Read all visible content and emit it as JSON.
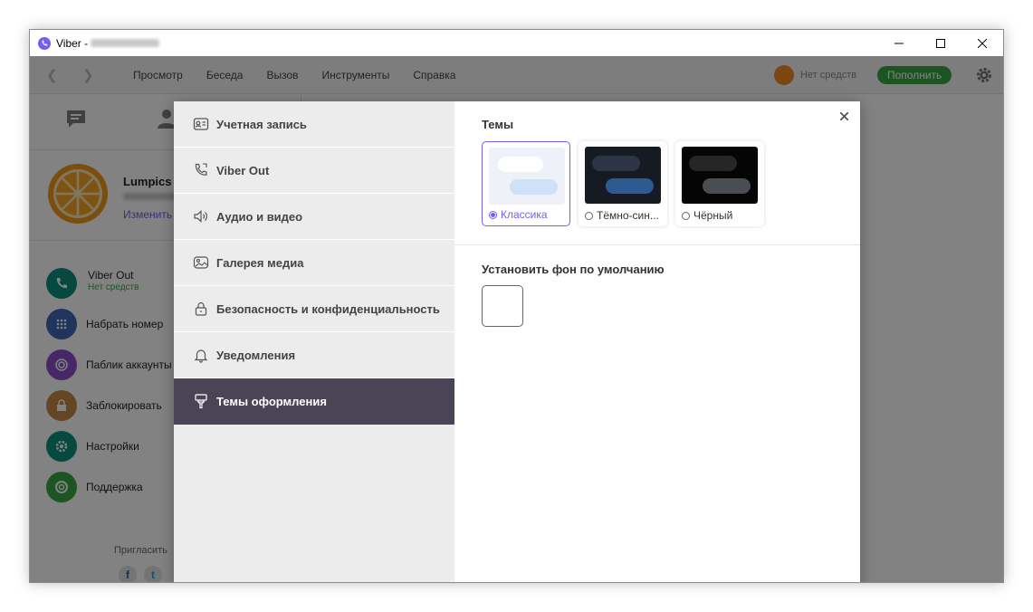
{
  "window": {
    "title": "Viber - ",
    "minimize": "minimize",
    "maximize": "maximize",
    "close": "close"
  },
  "toolbar": {
    "back": "❮",
    "forward": "❯",
    "menu": [
      "Просмотр",
      "Беседа",
      "Вызов",
      "Инструменты",
      "Справка"
    ],
    "balance_label": "Нет средств",
    "topup_label": "Пополнить"
  },
  "profile": {
    "name": "Lumpics",
    "edit_label": "Изменить"
  },
  "left_list": {
    "items": [
      {
        "label": "Viber Out",
        "sub": "Нет средств",
        "color": "#0d8f7d"
      },
      {
        "label": "Набрать номер",
        "color": "#3f67b8"
      },
      {
        "label": "Паблик аккаунты",
        "color": "#8a4fc9"
      },
      {
        "label": "Заблокировать",
        "color": "#c68a47"
      },
      {
        "label": "Настройки",
        "color": "#0d8f7d"
      },
      {
        "label": "Поддержка",
        "color": "#37a843"
      }
    ],
    "invite_label": "Пригласить"
  },
  "settings_menu": {
    "items": [
      {
        "label": "Учетная запись",
        "icon": "account-card-icon",
        "active": false
      },
      {
        "label": "Viber Out",
        "icon": "phone-icon",
        "active": false
      },
      {
        "label": "Аудио и видео",
        "icon": "speaker-icon",
        "active": false
      },
      {
        "label": "Галерея медиа",
        "icon": "gallery-icon",
        "active": false
      },
      {
        "label": "Безопасность и конфиденциальность",
        "icon": "lock-icon",
        "active": false
      },
      {
        "label": "Уведомления",
        "icon": "bell-icon",
        "active": false
      },
      {
        "label": "Темы оформления",
        "icon": "brush-icon",
        "active": true
      }
    ]
  },
  "themes": {
    "title": "Темы",
    "options": [
      {
        "label": "Классика",
        "selected": true,
        "bg": "#eef1f8",
        "bubble_in": "#ffffff",
        "bubble_out": "#cfe1f7"
      },
      {
        "label": "Тёмно-син...",
        "selected": false,
        "bg": "#161a23",
        "bubble_in": "#2c3446",
        "bubble_out": "#2e5a92"
      },
      {
        "label": "Чёрный",
        "selected": false,
        "bg": "#050505",
        "bubble_in": "#262626",
        "bubble_out": "#4a4d52"
      }
    ]
  },
  "background": {
    "title": "Установить фон по умолчанию"
  },
  "colors": {
    "accent": "#7360f2",
    "active_menu_bg": "#4b4456",
    "topup_green": "#37a843"
  }
}
